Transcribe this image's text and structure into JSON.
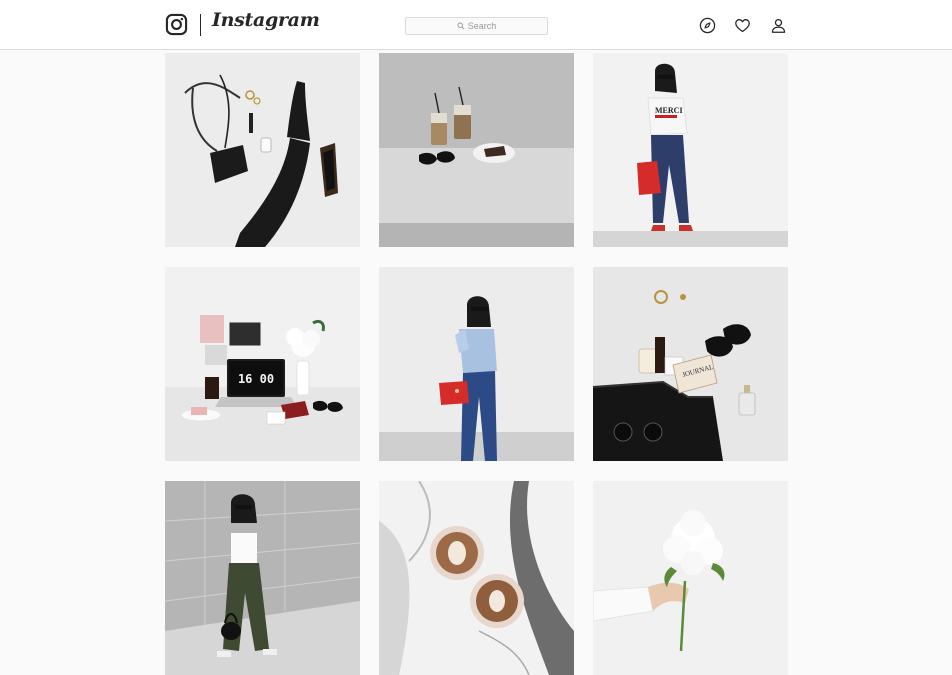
{
  "header": {
    "brand": "Instagram",
    "search": {
      "placeholder": "Search"
    },
    "icons": [
      "instagram-glyph-icon",
      "compass-icon",
      "heart-icon",
      "person-icon"
    ]
  },
  "theme": {
    "text": "#262626",
    "border": "#dbdbdb",
    "background": "#fafafa",
    "accent_red": "#d52b2b"
  },
  "clock_display": "16 00",
  "journal_label": "JOURNAL",
  "tshirt_text": "MERCI"
}
